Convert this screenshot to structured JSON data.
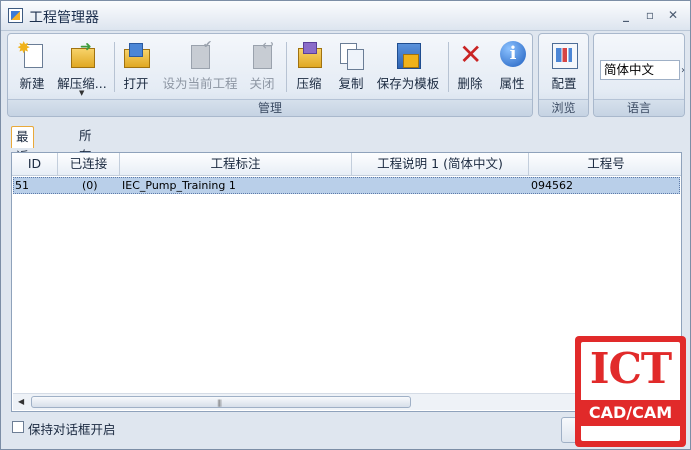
{
  "window": {
    "title": "工程管理器",
    "controls": {
      "minimize": "_",
      "maximize": "▫",
      "close": "✕"
    }
  },
  "ribbon": {
    "groups": [
      {
        "label": "管理",
        "buttons": [
          {
            "label": "新建",
            "icon": "new-icon",
            "enabled": true
          },
          {
            "label": "解压缩...",
            "icon": "unzip-icon",
            "enabled": true
          },
          {
            "label": "打开",
            "icon": "open-folder-icon",
            "enabled": true
          },
          {
            "label": "设为当前工程",
            "icon": "set-current-icon",
            "enabled": false
          },
          {
            "label": "关闭",
            "icon": "close-project-icon",
            "enabled": false
          },
          {
            "label": "压缩",
            "icon": "compress-icon",
            "enabled": true
          },
          {
            "label": "复制",
            "icon": "copy-icon",
            "enabled": true
          },
          {
            "label": "保存为模板",
            "icon": "save-template-icon",
            "enabled": true
          },
          {
            "label": "删除",
            "icon": "delete-icon",
            "enabled": true
          },
          {
            "label": "属性",
            "icon": "properties-icon",
            "enabled": true
          }
        ]
      },
      {
        "label": "浏览",
        "buttons": [
          {
            "label": "配置",
            "icon": "config-icon",
            "enabled": true
          }
        ]
      },
      {
        "label": "语言",
        "select_value": "简体中文"
      }
    ],
    "scroll_arrow": "›"
  },
  "tabs": [
    {
      "label": "最近工程",
      "active": true
    },
    {
      "label": "所有工程",
      "active": false
    }
  ],
  "table": {
    "columns": [
      "ID",
      "已连接",
      "工程标注",
      "工程说明 1 (简体中文)",
      "工程号"
    ],
    "rows": [
      {
        "id": "51",
        "connected": "(0)",
        "name": "IEC_Pump_Training 1",
        "description": "",
        "number": "094562"
      }
    ],
    "scroll": {
      "left": "◀",
      "right": "▶",
      "grip": "|||"
    }
  },
  "footer": {
    "checkbox_label": "保持对话框开启",
    "checked": false
  },
  "watermark": {
    "main": "ICT",
    "sub": "CAD/CAM",
    "color": "#e12a2a"
  },
  "colors": {
    "selection": "#b9cfe9",
    "ribbon_border": "#a9b8cc",
    "disabled_text": "#8d96a3",
    "delete_red": "#c92424"
  }
}
